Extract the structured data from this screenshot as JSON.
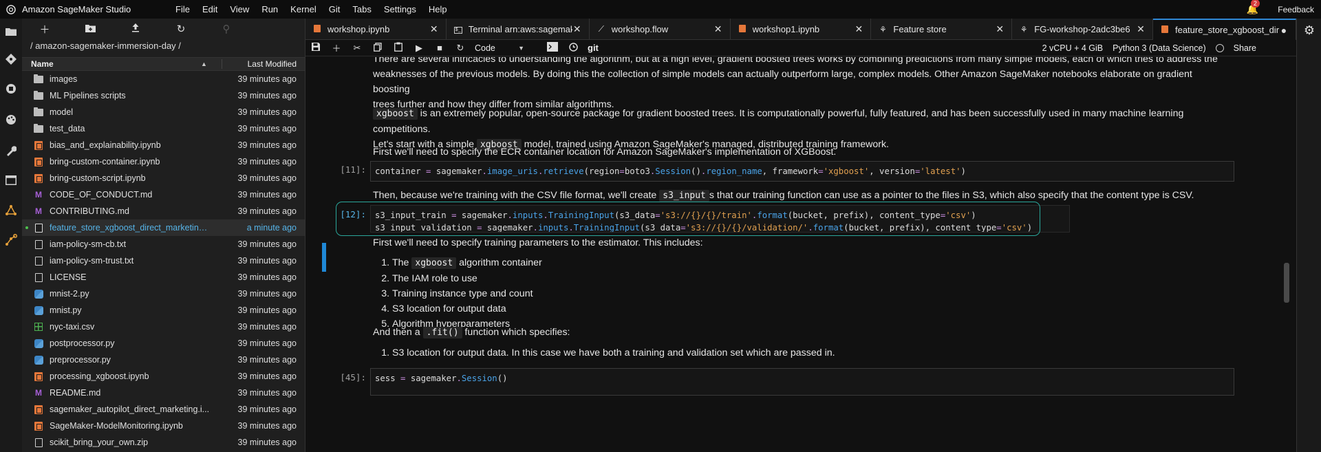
{
  "app": {
    "title": "Amazon SageMaker Studio"
  },
  "menu": [
    "File",
    "Edit",
    "View",
    "Run",
    "Kernel",
    "Git",
    "Tabs",
    "Settings",
    "Help"
  ],
  "header_right": {
    "notifications": "2",
    "feedback": "Feedback"
  },
  "filebrowser": {
    "path": "/ amazon-sagemaker-immersion-day /",
    "col_name": "Name",
    "col_modified": "Last Modified",
    "files": [
      {
        "name": "images",
        "type": "folder",
        "modified": "39 minutes ago"
      },
      {
        "name": "ML Pipelines scripts",
        "type": "folder",
        "modified": "39 minutes ago"
      },
      {
        "name": "model",
        "type": "folder",
        "modified": "39 minutes ago"
      },
      {
        "name": "test_data",
        "type": "folder",
        "modified": "39 minutes ago"
      },
      {
        "name": "bias_and_explainability.ipynb",
        "type": "notebook",
        "modified": "39 minutes ago"
      },
      {
        "name": "bring-custom-container.ipynb",
        "type": "notebook",
        "modified": "39 minutes ago"
      },
      {
        "name": "bring-custom-script.ipynb",
        "type": "notebook",
        "modified": "39 minutes ago"
      },
      {
        "name": "CODE_OF_CONDUCT.md",
        "type": "markdown",
        "modified": "39 minutes ago"
      },
      {
        "name": "CONTRIBUTING.md",
        "type": "markdown",
        "modified": "39 minutes ago"
      },
      {
        "name": "feature_store_xgboost_direct_marketing...",
        "type": "notebook-open",
        "modified": "a minute ago",
        "selected": true
      },
      {
        "name": "iam-policy-sm-cb.txt",
        "type": "file",
        "modified": "39 minutes ago"
      },
      {
        "name": "iam-policy-sm-trust.txt",
        "type": "file",
        "modified": "39 minutes ago"
      },
      {
        "name": "LICENSE",
        "type": "file",
        "modified": "39 minutes ago"
      },
      {
        "name": "mnist-2.py",
        "type": "python",
        "modified": "39 minutes ago"
      },
      {
        "name": "mnist.py",
        "type": "python",
        "modified": "39 minutes ago"
      },
      {
        "name": "nyc-taxi.csv",
        "type": "csv",
        "modified": "39 minutes ago"
      },
      {
        "name": "postprocessor.py",
        "type": "python",
        "modified": "39 minutes ago"
      },
      {
        "name": "preprocessor.py",
        "type": "python",
        "modified": "39 minutes ago"
      },
      {
        "name": "processing_xgboost.ipynb",
        "type": "notebook",
        "modified": "39 minutes ago"
      },
      {
        "name": "README.md",
        "type": "markdown",
        "modified": "39 minutes ago"
      },
      {
        "name": "sagemaker_autopilot_direct_marketing.i...",
        "type": "notebook",
        "modified": "39 minutes ago"
      },
      {
        "name": "SageMaker-ModelMonitoring.ipynb",
        "type": "notebook",
        "modified": "39 minutes ago"
      },
      {
        "name": "scikit_bring_your_own.zip",
        "type": "file",
        "modified": "39 minutes ago"
      }
    ]
  },
  "tabs": [
    {
      "label": "workshop.ipynb",
      "icon": "notebook"
    },
    {
      "label": "Terminal arn:aws:sagemake",
      "icon": "terminal"
    },
    {
      "label": "workshop.flow",
      "icon": "flow"
    },
    {
      "label": "workshop1.ipynb",
      "icon": "notebook"
    },
    {
      "label": "Feature store",
      "icon": "featurestore"
    },
    {
      "label": "FG-workshop-2adc3be6",
      "icon": "featurestore"
    },
    {
      "label": "feature_store_xgboost_dire",
      "icon": "notebook",
      "active": true
    }
  ],
  "nbtoolbar": {
    "cell_type": "Code",
    "git": "git",
    "instance": "2 vCPU + 4 GiB",
    "kernel": "Python 3 (Data Science)",
    "share": "Share"
  },
  "notebook": {
    "md1_line1": "There are several intricacies to understanding the algorithm, but at a high level, gradient boosted trees works by combining predictions from many simple models, each of which tries to address the",
    "md1_line2": "weaknesses of the previous models. By doing this the collection of simple models can actually outperform large, complex models. Other Amazon SageMaker notebooks elaborate on gradient boosting",
    "md1_line3": "trees further and how they differ from similar algorithms.",
    "md2_code": "xgboost",
    "md2_text1": " is an extremely popular, open-source package for gradient boosted trees. It is computationally powerful, fully featured, and has been successfully used in many machine learning competitions.",
    "md2_text2": "Let's start with a simple ",
    "md2_code2": "xgboost",
    "md2_text3": " model, trained using Amazon SageMaker's managed, distributed training framework.",
    "md3": "First we'll need to specify the ECR container location for Amazon SageMaker's implementation of XGBoost.",
    "cell11_prompt": "[11]:",
    "md4_text1": "Then, because we're training with the CSV file format, we'll create ",
    "md4_code": "s3_input",
    "md4_text2": "s that our training function can use as a pointer to the files in S3, which also specify that the content type is CSV.",
    "cell12_prompt": "[12]:",
    "md5": "First we'll need to specify training parameters to the estimator. This includes:",
    "list1_item1_pre": "The ",
    "list1_item1_code": "xgboost",
    "list1_item1_post": " algorithm container",
    "list1_item2": "The IAM role to use",
    "list1_item3": "Training instance type and count",
    "list1_item4": "S3 location for output data",
    "list1_item5": "Algorithm hyperparameters",
    "md6_pre": "And then a ",
    "md6_code": ".fit()",
    "md6_post": " function which specifies:",
    "list2_item1": "S3 location for output data. In this case we have both a training and validation set which are passed in.",
    "cell45_prompt": "[45]:"
  }
}
